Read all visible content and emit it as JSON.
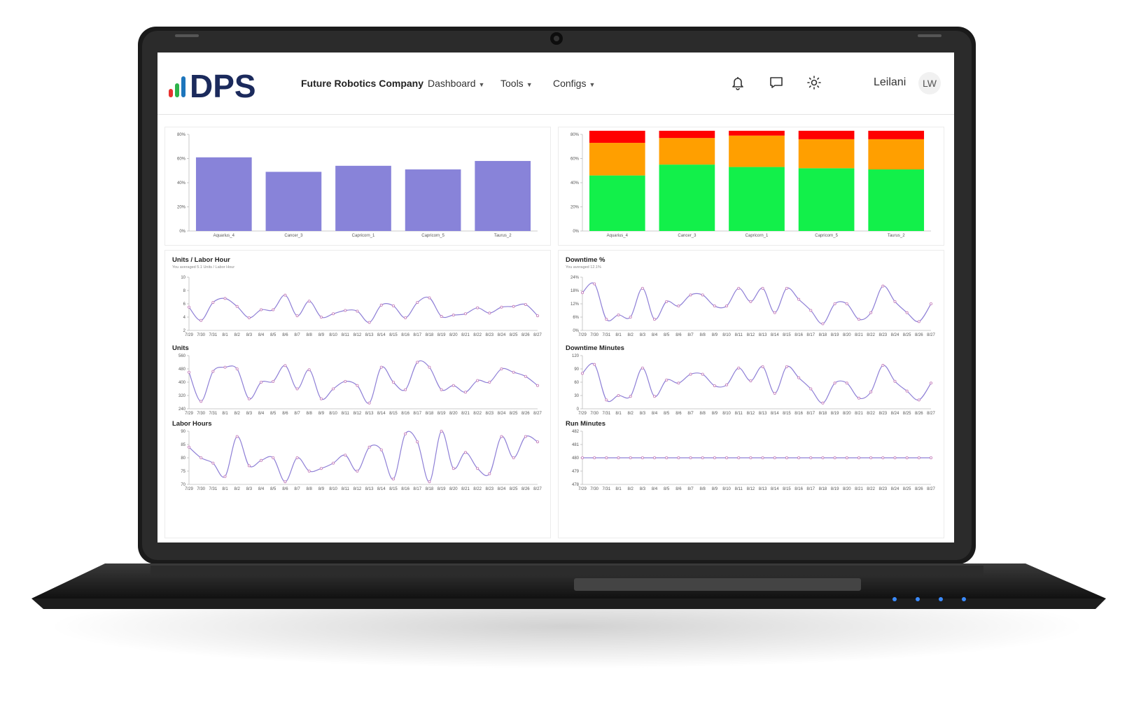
{
  "header": {
    "company": "Future Robotics Company",
    "menus": [
      "Dashboard",
      "Tools",
      "Configs"
    ],
    "user_name": "Leilani",
    "user_initials": "LW",
    "icons": [
      "bell-icon",
      "chat-icon",
      "sun-icon"
    ]
  },
  "logo": {
    "text": "DPS",
    "bar_colors": [
      "#e8312f",
      "#2db34a",
      "#1d75bc"
    ],
    "text_color": "#1b2a5c"
  },
  "chart_data": [
    {
      "type": "bar",
      "categories": [
        "Aquarius_4",
        "Cancer_3",
        "Capricorn_1",
        "Capricorn_5",
        "Taurus_2"
      ],
      "values": [
        61,
        49,
        54,
        51,
        58
      ],
      "yticks": [
        "0%",
        "20%",
        "40%",
        "60%",
        "80%"
      ],
      "ylim": [
        0,
        80
      ],
      "color": "#8883d9"
    },
    {
      "type": "bar",
      "stacked": true,
      "categories": [
        "Aquarius_4",
        "Cancer_3",
        "Capricorn_1",
        "Capricorn_5",
        "Taurus_2"
      ],
      "series": [
        {
          "values": [
            46,
            55,
            53,
            52,
            51
          ],
          "color": "#12f04a"
        },
        {
          "values": [
            27,
            22,
            26,
            24,
            25
          ],
          "color": "#ff9f00"
        },
        {
          "values": [
            10,
            6,
            4,
            7,
            7
          ],
          "color": "#ff0000"
        }
      ],
      "yticks": [
        "0%",
        "20%",
        "40%",
        "60%",
        "80%"
      ],
      "ylim": [
        0,
        80
      ]
    },
    {
      "type": "line",
      "title": "Units / Labor Hour",
      "subtitle": "You averaged 5.1 Units / Labor Hour",
      "x": [
        "7/29",
        "7/30",
        "7/31",
        "8/1",
        "8/2",
        "8/3",
        "8/4",
        "8/5",
        "8/6",
        "8/7",
        "8/8",
        "8/9",
        "8/10",
        "8/11",
        "8/12",
        "8/13",
        "8/14",
        "8/15",
        "8/16",
        "8/17",
        "8/18",
        "8/19",
        "8/20",
        "8/21",
        "8/22",
        "8/23",
        "8/24",
        "8/25",
        "8/26",
        "8/27"
      ],
      "values": [
        5.5,
        3.5,
        6.2,
        6.8,
        5.6,
        3.9,
        5.1,
        5.1,
        7.3,
        4.2,
        6.4,
        4,
        4.5,
        5,
        4.9,
        3.2,
        5.8,
        5.7,
        3.9,
        6.2,
        6.9,
        4.1,
        4.3,
        4.5,
        5.4,
        4.6,
        5.5,
        5.6,
        5.9,
        4.2
      ],
      "yticks": [
        "2",
        "4",
        "6",
        "8",
        "10"
      ],
      "ylim": [
        2,
        10
      ]
    },
    {
      "type": "line",
      "title": "Downtime %",
      "subtitle": "You averaged 12.1%",
      "x": [
        "7/29",
        "7/30",
        "7/31",
        "8/1",
        "8/2",
        "8/3",
        "8/4",
        "8/5",
        "8/6",
        "8/7",
        "8/8",
        "8/9",
        "8/10",
        "8/11",
        "8/12",
        "8/13",
        "8/14",
        "8/15",
        "8/16",
        "8/17",
        "8/18",
        "8/19",
        "8/20",
        "8/21",
        "8/22",
        "8/23",
        "8/24",
        "8/25",
        "8/26",
        "8/27"
      ],
      "values": [
        17,
        21,
        5,
        7,
        6,
        19,
        5,
        13,
        11,
        16,
        16,
        11,
        11,
        19,
        13,
        19,
        8,
        19,
        14,
        9,
        3,
        12,
        12,
        5,
        8,
        20,
        13,
        8,
        4,
        12
      ],
      "yticks": [
        "0%",
        "6%",
        "12%",
        "18%",
        "24%"
      ],
      "ylim": [
        0,
        24
      ]
    },
    {
      "type": "line",
      "title": "Units",
      "x": [
        "7/29",
        "7/30",
        "7/31",
        "8/1",
        "8/2",
        "8/3",
        "8/4",
        "8/5",
        "8/6",
        "8/7",
        "8/8",
        "8/9",
        "8/10",
        "8/11",
        "8/12",
        "8/13",
        "8/14",
        "8/15",
        "8/16",
        "8/17",
        "8/18",
        "8/19",
        "8/20",
        "8/21",
        "8/22",
        "8/23",
        "8/24",
        "8/25",
        "8/26",
        "8/27"
      ],
      "values": [
        460,
        285,
        465,
        490,
        480,
        300,
        400,
        405,
        500,
        360,
        475,
        300,
        360,
        405,
        380,
        275,
        490,
        400,
        355,
        520,
        490,
        355,
        380,
        340,
        410,
        400,
        480,
        460,
        435,
        380
      ],
      "yticks": [
        "240",
        "320",
        "400",
        "480",
        "560"
      ],
      "ylim": [
        240,
        560
      ]
    },
    {
      "type": "line",
      "title": "Downtime Minutes",
      "x": [
        "7/29",
        "7/30",
        "7/31",
        "8/1",
        "8/2",
        "8/3",
        "8/4",
        "8/5",
        "8/6",
        "8/7",
        "8/8",
        "8/9",
        "8/10",
        "8/11",
        "8/12",
        "8/13",
        "8/14",
        "8/15",
        "8/16",
        "8/17",
        "8/18",
        "8/19",
        "8/20",
        "8/21",
        "8/22",
        "8/23",
        "8/24",
        "8/25",
        "8/26",
        "8/27"
      ],
      "values": [
        80,
        100,
        20,
        30,
        28,
        92,
        28,
        65,
        58,
        78,
        78,
        52,
        54,
        92,
        63,
        95,
        35,
        95,
        70,
        45,
        13,
        58,
        58,
        24,
        38,
        98,
        62,
        40,
        20,
        58
      ],
      "yticks": [
        "0",
        "30",
        "60",
        "90",
        "120"
      ],
      "ylim": [
        0,
        120
      ]
    },
    {
      "type": "line",
      "title": "Labor Hours",
      "x": [
        "7/29",
        "7/30",
        "7/31",
        "8/1",
        "8/2",
        "8/3",
        "8/4",
        "8/5",
        "8/6",
        "8/7",
        "8/8",
        "8/9",
        "8/10",
        "8/11",
        "8/12",
        "8/13",
        "8/14",
        "8/15",
        "8/16",
        "8/17",
        "8/18",
        "8/19",
        "8/20",
        "8/21",
        "8/22",
        "8/23",
        "8/24",
        "8/25",
        "8/26",
        "8/27"
      ],
      "values": [
        84,
        80,
        78,
        73,
        88,
        77,
        79,
        80,
        71,
        80,
        75,
        76,
        78,
        81,
        75,
        84,
        83,
        72,
        89,
        86,
        71,
        90,
        76,
        82,
        76,
        74,
        88,
        80,
        88,
        86
      ],
      "yticks": [
        "70",
        "75",
        "80",
        "85",
        "90"
      ],
      "ylim": [
        70,
        90
      ]
    },
    {
      "type": "line",
      "title": "Run Minutes",
      "x": [
        "7/29",
        "7/30",
        "7/31",
        "8/1",
        "8/2",
        "8/3",
        "8/4",
        "8/5",
        "8/6",
        "8/7",
        "8/8",
        "8/9",
        "8/10",
        "8/11",
        "8/12",
        "8/13",
        "8/14",
        "8/15",
        "8/16",
        "8/17",
        "8/18",
        "8/19",
        "8/20",
        "8/21",
        "8/22",
        "8/23",
        "8/24",
        "8/25",
        "8/26",
        "8/27"
      ],
      "values": [
        480,
        480,
        480,
        480,
        480,
        480,
        480,
        480,
        480,
        480,
        480,
        480,
        480,
        480,
        480,
        480,
        480,
        480,
        480,
        480,
        480,
        480,
        480,
        480,
        480,
        480,
        480,
        480,
        480,
        480
      ],
      "yticks": [
        "478",
        "479",
        "480",
        "481",
        "482"
      ],
      "ylim": [
        478,
        482
      ]
    }
  ]
}
